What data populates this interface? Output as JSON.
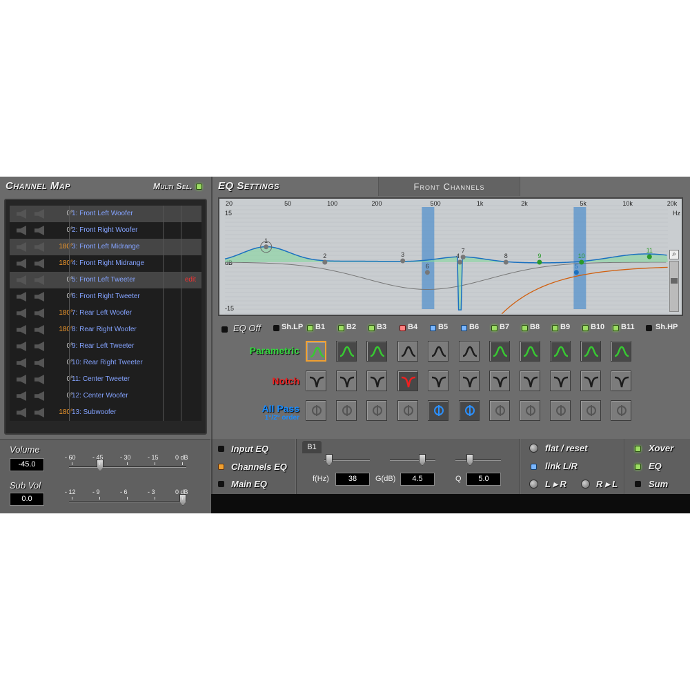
{
  "channel_map": {
    "title": "Channel Map",
    "multi_sel_label": "Multi Sel.",
    "channels": [
      {
        "phase": "0°",
        "name": "1: Front Left Woofer",
        "phase_color": "white",
        "highlight": true,
        "edit": ""
      },
      {
        "phase": "0°",
        "name": "2: Front Right Woofer",
        "phase_color": "white",
        "highlight": false,
        "edit": ""
      },
      {
        "phase": "180°",
        "name": "3: Front Left Midrange",
        "phase_color": "orange",
        "highlight": true,
        "edit": ""
      },
      {
        "phase": "180°",
        "name": "4: Front Right Midrange",
        "phase_color": "orange",
        "highlight": false,
        "edit": ""
      },
      {
        "phase": "0°",
        "name": "5: Front Left Tweeter",
        "phase_color": "white",
        "highlight": true,
        "edit": "edit"
      },
      {
        "phase": "0°",
        "name": "6: Front Right Tweeter",
        "phase_color": "white",
        "highlight": false,
        "edit": ""
      },
      {
        "phase": "180°",
        "name": "7: Rear Left Woofer",
        "phase_color": "orange",
        "highlight": false,
        "edit": ""
      },
      {
        "phase": "180°",
        "name": "8: Rear Right Woofer",
        "phase_color": "orange",
        "highlight": false,
        "edit": ""
      },
      {
        "phase": "0°",
        "name": "9: Rear Left Tweeter",
        "phase_color": "white",
        "highlight": false,
        "edit": ""
      },
      {
        "phase": "0°",
        "name": "10: Rear Right Tweeter",
        "phase_color": "white",
        "highlight": false,
        "edit": ""
      },
      {
        "phase": "0°",
        "name": "11: Center Tweeter",
        "phase_color": "white",
        "highlight": false,
        "edit": ""
      },
      {
        "phase": "0°",
        "name": "12: Center Woofer",
        "phase_color": "white",
        "highlight": false,
        "edit": ""
      },
      {
        "phase": "180°",
        "name": "13: Subwoofer",
        "phase_color": "orange",
        "highlight": false,
        "edit": ""
      }
    ]
  },
  "eq": {
    "title": "EQ Settings",
    "channel_group": "Front Channels",
    "graph": {
      "freq_labels": [
        "20",
        "50",
        "100",
        "200",
        "500",
        "1k",
        "2k",
        "5k",
        "10k",
        "20k"
      ],
      "hz_label": "Hz",
      "db_top": "15",
      "db_mid": "dB",
      "db_bottom": "-15"
    },
    "eq_off_label": "EQ Off",
    "shlp_label": "Sh.LP",
    "shhp_label": "Sh.HP",
    "bands": [
      "B1",
      "B2",
      "B3",
      "B4",
      "B5",
      "B6",
      "B7",
      "B8",
      "B9",
      "B10",
      "B11"
    ],
    "band_led": [
      "g",
      "g",
      "g",
      "r",
      "b",
      "b",
      "g",
      "g",
      "g",
      "g",
      "g"
    ],
    "filter_types": {
      "parametric": "Parametric",
      "notch": "Notch",
      "all_pass": "All Pass",
      "all_pass_sub": "1°/2° order"
    },
    "points": [
      "1",
      "2",
      "3",
      "4",
      "5",
      "6",
      "7",
      "8",
      "9",
      "10",
      "11"
    ]
  },
  "volume": {
    "volume_label": "Volume",
    "volume_value": "-45.0",
    "volume_scale": [
      "- 60",
      "- 45",
      "- 30",
      "- 15",
      "0 dB"
    ],
    "volume_level_db": -45,
    "subvol_label": "Sub Vol",
    "subvol_value": "0.0",
    "subvol_scale": [
      "- 12",
      "- 9",
      "- 6",
      "- 3",
      "0 dB"
    ],
    "subvol_level_db": 0
  },
  "eq_mode": {
    "input": "Input EQ",
    "channels": "Channels EQ",
    "main": "Main EQ"
  },
  "band_edit": {
    "band_tab": "B1",
    "f_label": "f(Hz)",
    "f_value": "38",
    "g_label": "G(dB)",
    "g_value": "4.5",
    "q_label": "Q",
    "q_value": "5.0"
  },
  "actions": {
    "flat_reset": "flat / reset",
    "link_lr": "link L/R",
    "l_to_r": "L ▸ R",
    "r_to_l": "R ▸ L"
  },
  "outputs": {
    "xover": "Xover",
    "eq": "EQ",
    "sum": "Sum"
  }
}
